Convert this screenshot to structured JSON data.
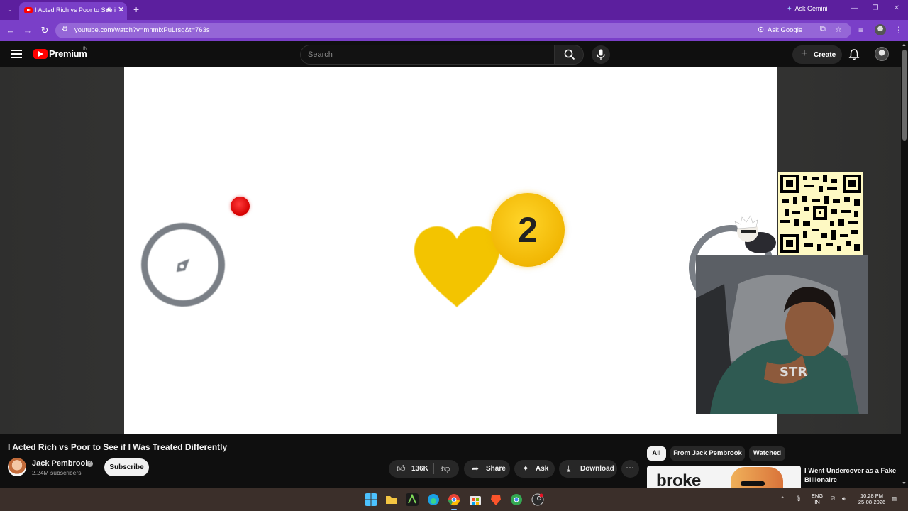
{
  "browser": {
    "tab_title": "I Acted Rich vs Poor to See if I Was Treated Differently",
    "ask_gemini": "Ask Gemini",
    "url": "youtube.com/watch?v=mnmixPuLrsg&t=763s",
    "ask_google": "Ask Google",
    "colors": {
      "frame": "#5c1f9e",
      "toolbar": "#7a3fc8"
    }
  },
  "youtube": {
    "premium_label": "Premium",
    "country": "IN",
    "search_placeholder": "Search",
    "create_label": "Create"
  },
  "player": {
    "badge_count": "2"
  },
  "video": {
    "title": "I Acted Rich vs Poor to See if I Was Treated Differently",
    "channel": "Jack Pembrook",
    "subscribers": "2.24M subscribers",
    "subscribe_label": "Subscribe",
    "likes": "136K",
    "share_label": "Share",
    "ask_label": "Ask",
    "download_label": "Download"
  },
  "recommendations": {
    "chips": [
      "All",
      "From Jack Pembrook",
      "Watched"
    ],
    "first": {
      "thumb_text": "broke",
      "title": "I Went Undercover as a Fake Billionaire"
    }
  },
  "taskbar": {
    "lang_top": "ENG",
    "lang_bottom": "IN",
    "time": "10:28 PM",
    "date": "25-08-2026"
  }
}
